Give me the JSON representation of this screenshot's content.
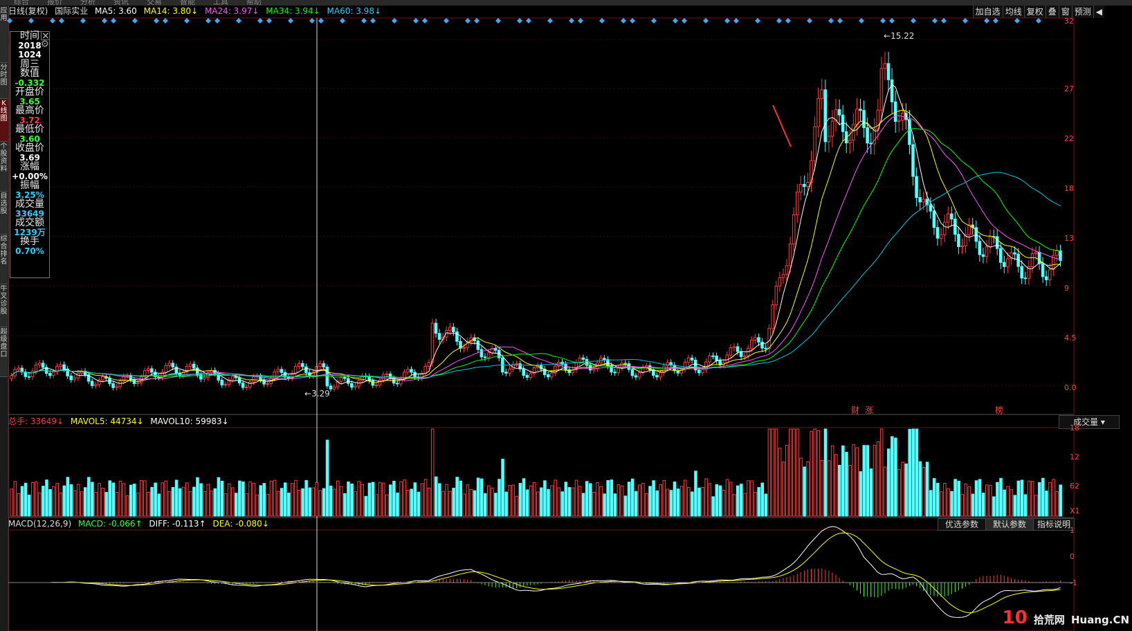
{
  "window": {
    "topbar_items": [
      "综合",
      "报价",
      "分析",
      "资讯",
      "交易",
      "智能",
      "工具",
      "帮助"
    ]
  },
  "left_tabs": [
    "应用",
    "分时图",
    "K线图",
    "个股资料",
    "自选股",
    "综合排名",
    "牛叉诊股",
    "超级盘口"
  ],
  "legend": {
    "period": "日线(复权)",
    "stock": "国际实业",
    "ma5": "MA5: 3.60",
    "ma14": "MA14: 3.80↓",
    "ma24": "MA24: 3.97↓",
    "ma34": "MA34: 3.94↓",
    "ma60": "MA60: 3.98↓"
  },
  "toolbar": [
    "加自选",
    "均线",
    "复权",
    "叠",
    "窗",
    "预测",
    "◀"
  ],
  "info_panel": {
    "time_label": "时间",
    "year": "2018",
    "date": "1024",
    "weekday": "周三",
    "value_label": "数值",
    "value": "-0.332",
    "open_label": "开盘价",
    "open": "3.65",
    "high_label": "最高价",
    "high": "3.72",
    "low_label": "最低价",
    "low": "3.60",
    "close_label": "收盘价",
    "close": "3.69",
    "change_label": "涨幅",
    "change": "+0.00%",
    "amplitude_label": "振幅",
    "amplitude": "3.25%",
    "volume_label": "成交量",
    "volume": "33649",
    "amount_label": "成交额",
    "amount": "1239万",
    "turnover_label": "换手",
    "turnover": "0.70%"
  },
  "price_axis": [
    "32",
    "27",
    "22",
    "18",
    "13",
    "9",
    "4.5",
    "0.0"
  ],
  "annotations": {
    "high": "15.22",
    "low": "3.29",
    "tag_cai": "财",
    "tag_zhang": "涨",
    "tag_bang": "榜"
  },
  "volume": {
    "total": "总手: 33649↓",
    "mavol5": "MAVOL5: 44734↓",
    "mavol10": "MAVOL10: 59983↓",
    "selector": "成交量",
    "axis": [
      "18",
      "12",
      "62",
      "X1"
    ]
  },
  "macd": {
    "name": "MACD(12,26,9)",
    "macd": "MACD: -0.066↑",
    "diff": "DIFF: -0.113↑",
    "dea": "DEA: -0.080↓",
    "btn_optimize": "优选参数",
    "btn_default": "默认参数",
    "btn_help": "指标说明",
    "axis": [
      "1",
      "0",
      "-1"
    ]
  },
  "watermark": {
    "brand": "10",
    "site": "拾荒网",
    "domain": "Huang.CN"
  },
  "colors": {
    "up": "#ff3b3b",
    "down": "#54ffff",
    "ma5": "#ffffff",
    "ma14": "#ffff00",
    "ma24": "#ff55ff",
    "ma34": "#00ff00",
    "ma60": "#00c8e0",
    "text_label": "#e8e8e8"
  }
}
